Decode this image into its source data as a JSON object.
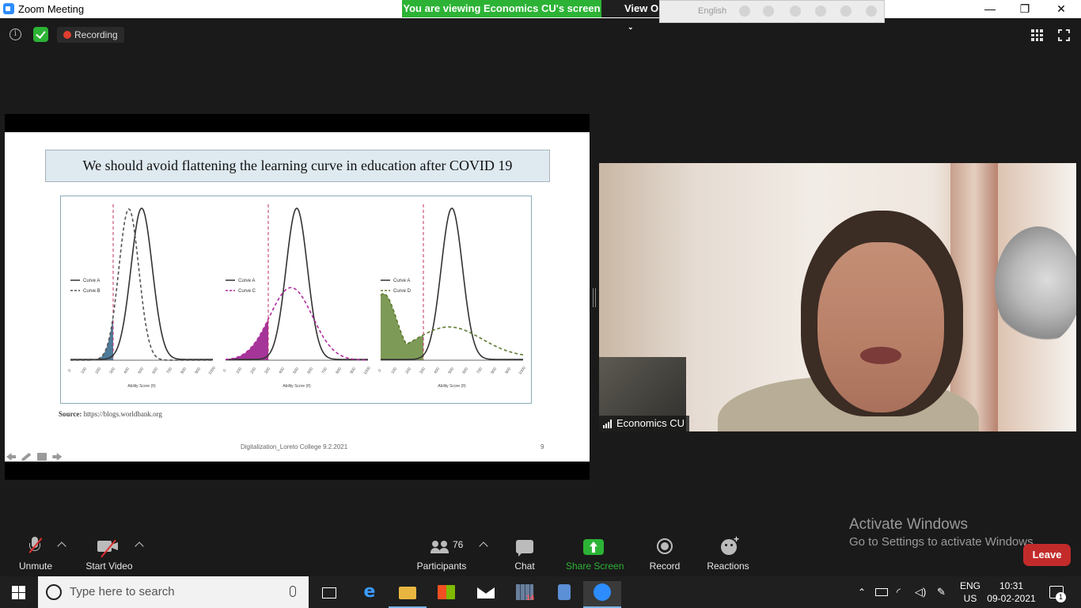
{
  "window": {
    "title": "Zoom Meeting",
    "minimize": "—",
    "restore": "❐",
    "close": "✕"
  },
  "banner": {
    "viewing_text": "You are viewing Economics CU's screen",
    "view_options": "View Options",
    "language": "English"
  },
  "meeting_top": {
    "recording_label": "Recording"
  },
  "slide": {
    "title": "We should avoid flattening the learning curve in education after COVID 19",
    "source_label": "Source:",
    "source_url": "https://blogs.worldbank.org",
    "footer": "Digitalization_Loreto College 9.2.2021",
    "page_number": "9"
  },
  "chart_data": [
    {
      "type": "area",
      "series": [
        {
          "name": "Curve A",
          "style": "solid",
          "color": "#333333"
        },
        {
          "name": "Curve B",
          "style": "dashed",
          "color": "#555555",
          "fill": "#3c6e8f"
        }
      ],
      "xlabel": "Ability Score (θ)",
      "x_ticks": [
        "0",
        "100",
        "200",
        "300",
        "400",
        "500",
        "600",
        "700",
        "800",
        "900",
        "1000"
      ],
      "threshold": 300,
      "curve_a": {
        "mean": 500,
        "sd": 75
      },
      "curve_b": {
        "mean": 410,
        "sd": 70
      }
    },
    {
      "type": "area",
      "series": [
        {
          "name": "Curve A",
          "style": "solid",
          "color": "#333333"
        },
        {
          "name": "Curve C",
          "style": "dashed",
          "color": "#b02a9e",
          "fill": "#9b1f8e"
        }
      ],
      "xlabel": "Ability Score (θ)",
      "x_ticks": [
        "0",
        "100",
        "200",
        "300",
        "400",
        "500",
        "600",
        "700",
        "800",
        "900",
        "1000"
      ],
      "threshold": 300,
      "curve_a": {
        "mean": 500,
        "sd": 75
      },
      "curve_c": {
        "mean": 460,
        "sd": 150,
        "peak_ratio": 0.48
      }
    },
    {
      "type": "area",
      "series": [
        {
          "name": "Curve A",
          "style": "solid",
          "color": "#333333"
        },
        {
          "name": "Curve D",
          "style": "dashed",
          "color": "#5e7a30",
          "fill": "#6f8f45"
        }
      ],
      "xlabel": "Ability Score (θ)",
      "x_ticks": [
        "0",
        "100",
        "200",
        "300",
        "400",
        "500",
        "600",
        "700",
        "800",
        "900",
        "1000"
      ],
      "threshold": 300,
      "curve_a": {
        "mean": 500,
        "sd": 75
      }
    }
  ],
  "video": {
    "participant_name": "Economics CU"
  },
  "toolbar": {
    "unmute": "Unmute",
    "start_video": "Start Video",
    "participants": "Participants",
    "participants_count": "76",
    "chat": "Chat",
    "share_screen": "Share Screen",
    "record": "Record",
    "reactions": "Reactions",
    "leave": "Leave"
  },
  "watermark": {
    "line1": "Activate Windows",
    "line2": "Go to Settings to activate Windows."
  },
  "taskbar": {
    "search_placeholder": "Type here to search",
    "lang_top": "ENG",
    "lang_bottom": "US",
    "time": "10:31",
    "date": "09-02-2021",
    "notification_count": "1",
    "calendar_badge": "14"
  },
  "colors": {
    "green": "#2cb335",
    "leave_red": "#c32b2b",
    "accent_blue": "#2d8cff"
  }
}
